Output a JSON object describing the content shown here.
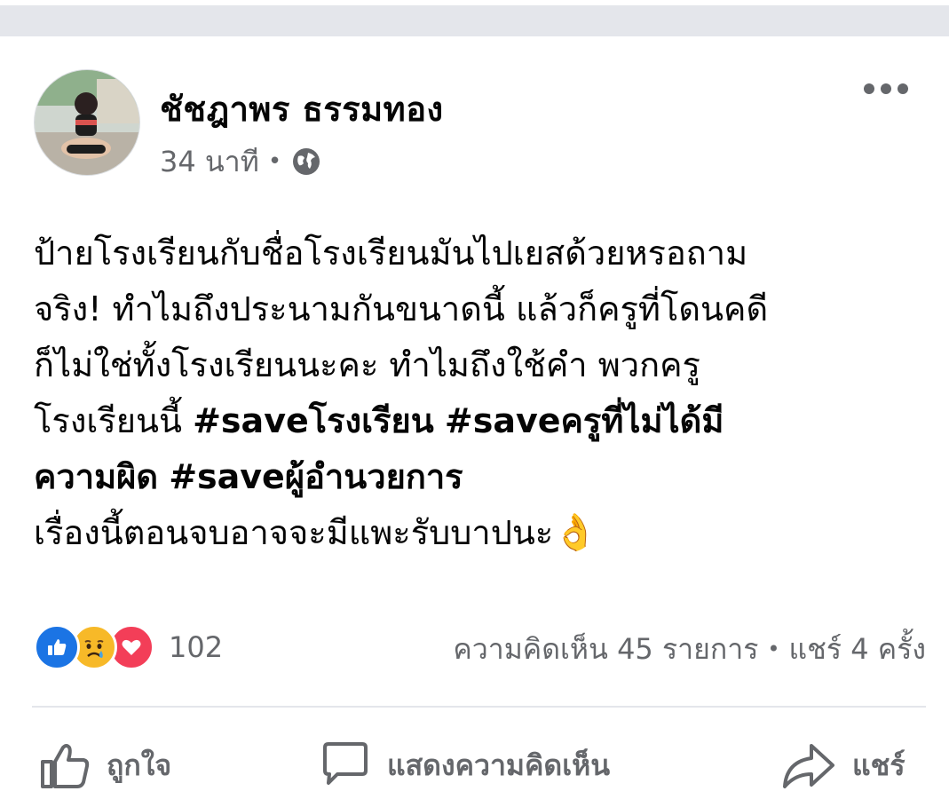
{
  "post": {
    "author": "ชัชฎาพร ธรรมทอง",
    "time": "34 นาที",
    "privacy_icon": "globe-icon",
    "text_lines": [
      "ป้ายโรงเรียนกับชื่อโรงเรียนมันไปเยสด้วยหรอถาม",
      "จริง! ทำไมถึงประนามกันขนาดนี้ แล้วก็ครูที่โดนคดี",
      "ก็ไม่ใช่ทั้งโรงเรียนนะคะ ทำไมถึงใช้คำ พวกครู"
    ],
    "line4_prefix": "โรงเรียนนี้",
    "hashtags": [
      "#saveโรงเรียน",
      "#saveครูที่ไม่ได้มี",
      "ความผิด",
      "#saveผู้อำนวยการ"
    ],
    "last_line": "เรื่องนี้ตอนจบอาจจะมีแพะรับบาปนะ",
    "last_emoji": "👌",
    "reactions": {
      "icons": [
        "like-icon",
        "sad-icon",
        "love-icon"
      ],
      "count": "102"
    },
    "comments": "ความคิดเห็น 45 รายการ",
    "shares": "แชร์ 4 ครั้ง",
    "separator": "•"
  },
  "actions": {
    "like": "ถูกใจ",
    "comment": "แสดงความคิดเห็น",
    "share": "แชร์"
  },
  "colors": {
    "secondary_text": "#65676b",
    "like_blue": "#1b74e4",
    "love_red": "#f33e58",
    "sad_yellow": "#f7b928",
    "divider": "#e4e6eb"
  }
}
